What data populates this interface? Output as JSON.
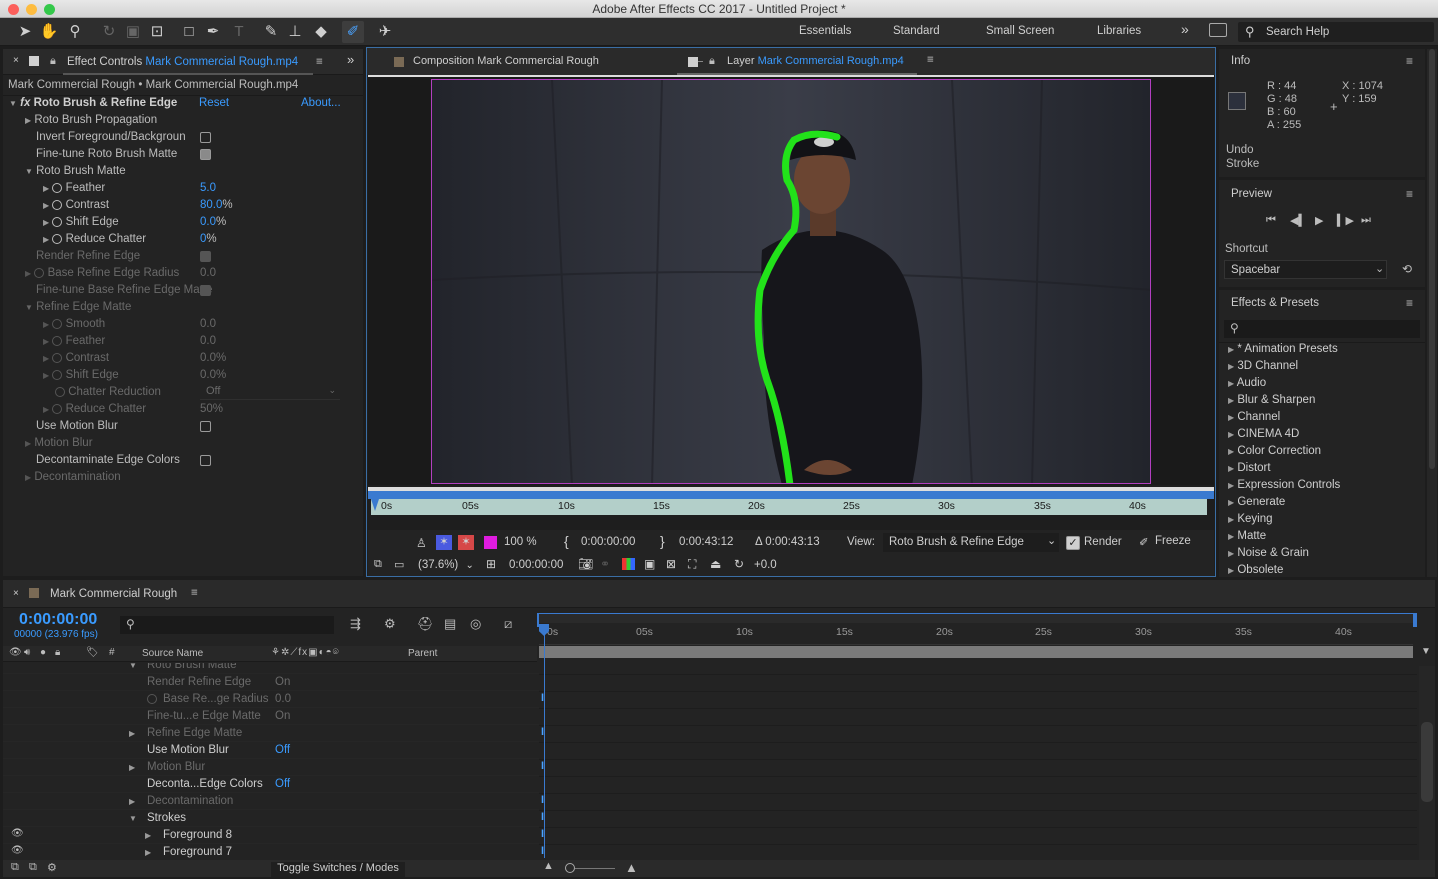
{
  "window": {
    "title": "Adobe After Effects CC 2017 - Untitled Project *"
  },
  "workspaces": [
    "Essentials",
    "Standard",
    "Small Screen",
    "Libraries"
  ],
  "search_help": {
    "placeholder": "Search Help"
  },
  "effect_controls": {
    "tab_prefix": "Effect Controls",
    "tab_file": "Mark Commercial Rough.mp4",
    "breadcrumb": "Mark Commercial Rough • Mark Commercial Rough.mp4",
    "effect_name": "Roto Brush & Refine Edge",
    "reset": "Reset",
    "about": "About...",
    "rows": {
      "propagation": "Roto Brush Propagation",
      "invert": "Invert Foreground/Backgroun",
      "finetune": "Fine-tune Roto Brush Matte",
      "matte": "Roto Brush Matte",
      "feather": "Feather",
      "feather_val": "5.0",
      "contrast": "Contrast",
      "contrast_val": "80.0",
      "shift": "Shift Edge",
      "shift_val": "0.0",
      "reduce": "Reduce Chatter",
      "reduce_val": "0",
      "render_refine": "Render Refine Edge",
      "base_radius": "Base Refine Edge Radius",
      "base_radius_val": "0.0",
      "finetune_base": "Fine-tune Base Refine Edge Matte",
      "refine_matte": "Refine Edge Matte",
      "smooth": "Smooth",
      "smooth_val": "0.0",
      "r_feather": "Feather",
      "r_feather_val": "0.0",
      "r_contrast": "Contrast",
      "r_contrast_val": "0.0%",
      "r_shift": "Shift Edge",
      "r_shift_val": "0.0%",
      "chatter_red": "Chatter Reduction",
      "chatter_red_val": "Off",
      "r_reduce": "Reduce Chatter",
      "r_reduce_val": "50%",
      "use_mb": "Use Motion Blur",
      "motion_blur": "Motion Blur",
      "decontam_colors": "Decontaminate Edge Colors",
      "decontamination": "Decontamination"
    }
  },
  "viewer": {
    "comp_tab_prefix": "Composition",
    "comp_tab_name": "Mark Commercial Rough",
    "layer_tab_prefix": "Layer",
    "layer_tab_name": "Mark Commercial Rough.mp4",
    "ruler": [
      "0s",
      "05s",
      "10s",
      "15s",
      "20s",
      "25s",
      "30s",
      "35s",
      "40s"
    ],
    "zoom_pct": "100",
    "in_point": "0:00:00:00",
    "out_point": "0:00:43:12",
    "duration": "Δ 0:00:43:13",
    "view_label": "View:",
    "view_value": "Roto Brush & Refine Edge",
    "render_label": "Render",
    "freeze_label": "Freeze",
    "magnification": "(37.6%)",
    "current_time": "0:00:00:00",
    "exposure": "+0.0"
  },
  "info": {
    "title": "Info",
    "r": "R : 44",
    "g": "G : 48",
    "b": "B : 60",
    "a": "A : 255",
    "x": "X : 1074",
    "y": "Y : 159",
    "undo_line1": "Undo",
    "undo_line2": "Stroke",
    "swatch_color": "#2c303c"
  },
  "preview": {
    "title": "Preview",
    "shortcut_label": "Shortcut",
    "shortcut_value": "Spacebar"
  },
  "effects_presets": {
    "title": "Effects & Presets",
    "items": [
      "* Animation Presets",
      "3D Channel",
      "Audio",
      "Blur & Sharpen",
      "Channel",
      "CINEMA 4D",
      "Color Correction",
      "Distort",
      "Expression Controls",
      "Generate",
      "Keying",
      "Matte",
      "Noise & Grain",
      "Obsolete"
    ]
  },
  "timeline": {
    "comp_name": "Mark Commercial Rough",
    "timecode": "0:00:00:00",
    "frames": "00000 (23.976 fps)",
    "col_source": "Source Name",
    "col_parent": "Parent",
    "ruler": [
      "0s",
      "05s",
      "10s",
      "15s",
      "20s",
      "25s",
      "30s",
      "35s",
      "40s"
    ],
    "rows": [
      {
        "name": "Roto Brush Matte",
        "value": ""
      },
      {
        "name": "Render Refine Edge",
        "value": "On"
      },
      {
        "name": "Base Re...ge Radius",
        "value": "0.0"
      },
      {
        "name": "Fine-tu...e Edge Matte",
        "value": "On"
      },
      {
        "name": "Refine Edge Matte",
        "value": ""
      },
      {
        "name": "Use Motion Blur",
        "value": "Off"
      },
      {
        "name": "Motion Blur",
        "value": ""
      },
      {
        "name": "Deconta...Edge Colors",
        "value": "Off"
      },
      {
        "name": "Decontamination",
        "value": ""
      },
      {
        "name": "Strokes",
        "value": ""
      },
      {
        "name": "Foreground 8",
        "value": ""
      },
      {
        "name": "Foreground 7",
        "value": ""
      }
    ],
    "toggle_label": "Toggle Switches / Modes"
  },
  "colors": {
    "accent": "#3a9bff",
    "stroke_green": "#22e21a",
    "layer_border": "#b23fc0"
  }
}
